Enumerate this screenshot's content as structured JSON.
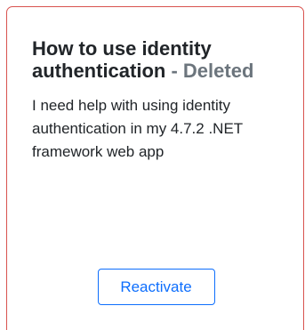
{
  "card": {
    "title": "How to use identity authentication",
    "separator": " - ",
    "status": "Deleted",
    "description": "I need help with using identity authentication in my 4.7.2 .NET framework web app",
    "reactivate_label": "Reactivate",
    "border_color": "#d9534f",
    "button_color": "#0d6efd"
  }
}
